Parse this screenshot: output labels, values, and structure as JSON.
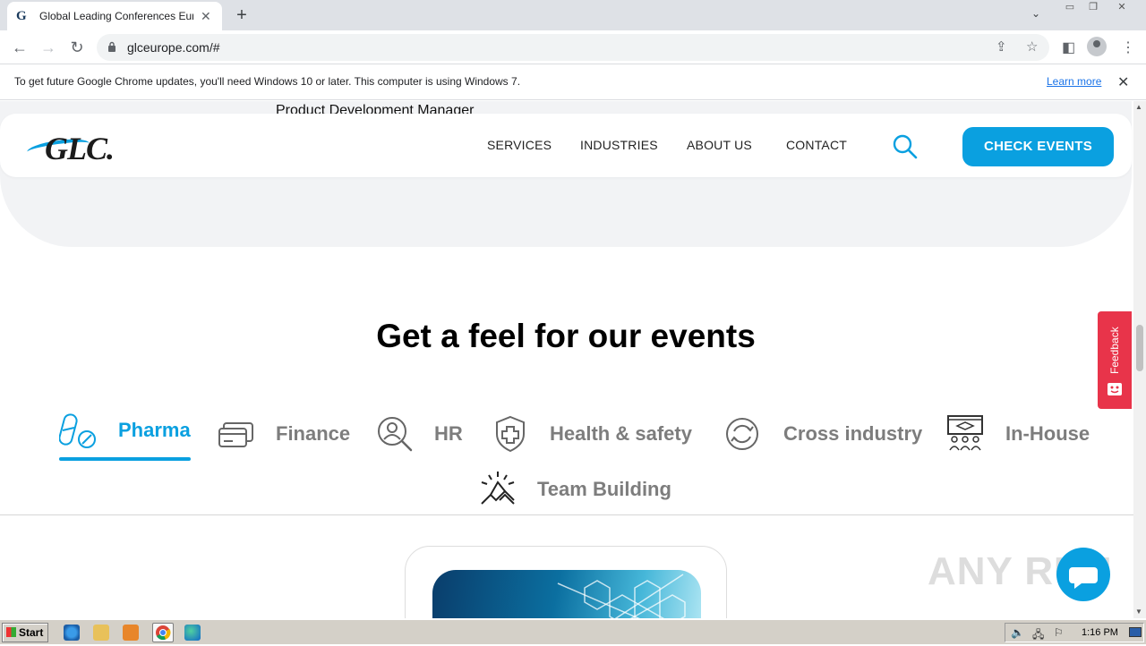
{
  "browser": {
    "tab_title": "Global Leading Conferences Europe",
    "tab_favicon": "G",
    "url": "glceurope.com/#",
    "infobar_message": "To get future Google Chrome updates, you'll need Windows 10 or later. This computer is using Windows 7.",
    "infobar_link": "Learn more"
  },
  "page": {
    "hero_text": "Product Development Manager",
    "logo": "GLC.",
    "menu": [
      "SERVICES",
      "INDUSTRIES",
      "ABOUT US",
      "CONTACT"
    ],
    "cta": "CHECK EVENTS",
    "heading": "Get a feel for our events",
    "categories": [
      {
        "label": "Pharma",
        "icon": "pills-icon",
        "active": true
      },
      {
        "label": "Finance",
        "icon": "credit-card-icon",
        "active": false
      },
      {
        "label": "HR",
        "icon": "person-search-icon",
        "active": false
      },
      {
        "label": "Health & safety",
        "icon": "shield-cross-icon",
        "active": false
      },
      {
        "label": "Cross industry",
        "icon": "refresh-icon",
        "active": false
      },
      {
        "label": "In-House",
        "icon": "classroom-icon",
        "active": false
      },
      {
        "label": "Team Building",
        "icon": "handshake-icon",
        "active": false
      }
    ],
    "feedback": "Feedback",
    "watermark": "ANY RUN"
  },
  "taskbar": {
    "start": "Start",
    "clock": "1:16 PM"
  },
  "colors": {
    "accent": "#0aa0e0",
    "feedback": "#e8344a",
    "inactive_label": "#7d7d7d"
  }
}
